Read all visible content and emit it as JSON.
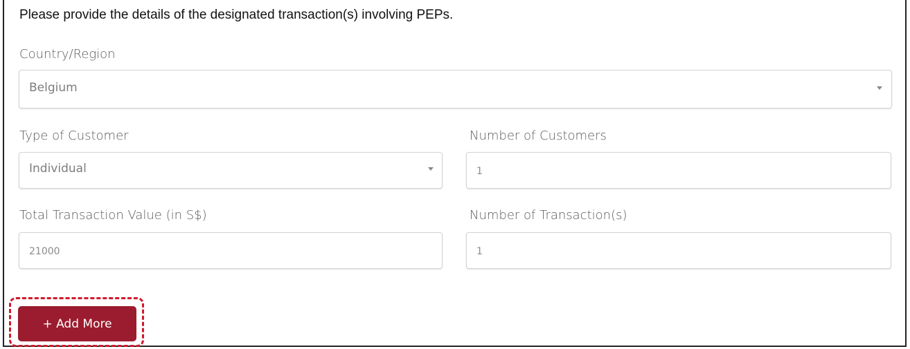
{
  "form": {
    "heading": "Please provide the details of the designated transaction(s) involving PEPs.",
    "country": {
      "label": "Country/Region",
      "value": "Belgium"
    },
    "customer_type": {
      "label": "Type of Customer",
      "value": "Individual"
    },
    "num_customers": {
      "label": "Number of Customers",
      "value": "1"
    },
    "total_value": {
      "label": "Total Transaction Value (in S$)",
      "value": "21000"
    },
    "num_transactions": {
      "label": "Number of Transaction(s)",
      "value": "1"
    },
    "add_more_label": "+ Add More"
  },
  "colors": {
    "button_bg": "#9b1c2e",
    "highlight_border": "#d0192b",
    "frame_border": "#222222"
  },
  "icons": {
    "dropdown": "chevron-down-icon"
  }
}
